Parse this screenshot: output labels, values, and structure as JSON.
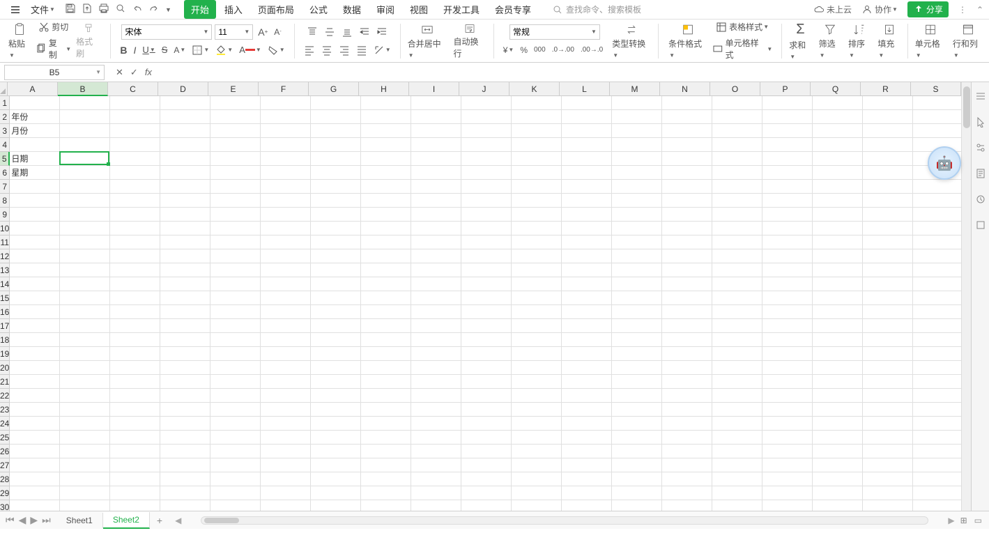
{
  "menu": {
    "file": "文件"
  },
  "tabs": [
    "开始",
    "插入",
    "页面布局",
    "公式",
    "数据",
    "审阅",
    "视图",
    "开发工具",
    "会员专享"
  ],
  "activeTab": 0,
  "search": {
    "placeholder": "查找命令、搜索模板"
  },
  "topRight": {
    "cloud": "未上云",
    "collab": "协作",
    "share": "分享"
  },
  "ribbon": {
    "paste": "粘贴",
    "cut": "剪切",
    "copy": "复制",
    "format": "格式刷",
    "font": "宋体",
    "size": "11",
    "merge": "合并居中",
    "wrap": "自动换行",
    "numFormat": "常规",
    "typeConv": "类型转换",
    "condFmt": "条件格式",
    "tableStyle": "表格样式",
    "cellStyle": "单元格样式",
    "sum": "求和",
    "filter": "筛选",
    "sort": "排序",
    "fill": "填充",
    "cell": "单元格",
    "rowcol": "行和列"
  },
  "nameBox": "B5",
  "columns": [
    "A",
    "B",
    "C",
    "D",
    "E",
    "F",
    "G",
    "H",
    "I",
    "J",
    "K",
    "L",
    "M",
    "N",
    "O",
    "P",
    "Q",
    "R",
    "S"
  ],
  "rows": 31,
  "selectedCol": 1,
  "selectedRow": 4,
  "cells": {
    "A2": "年份",
    "A3": "月份",
    "A5": "日期",
    "A6": "星期"
  },
  "sheets": [
    "Sheet1",
    "Sheet2"
  ],
  "activeSheet": 1
}
